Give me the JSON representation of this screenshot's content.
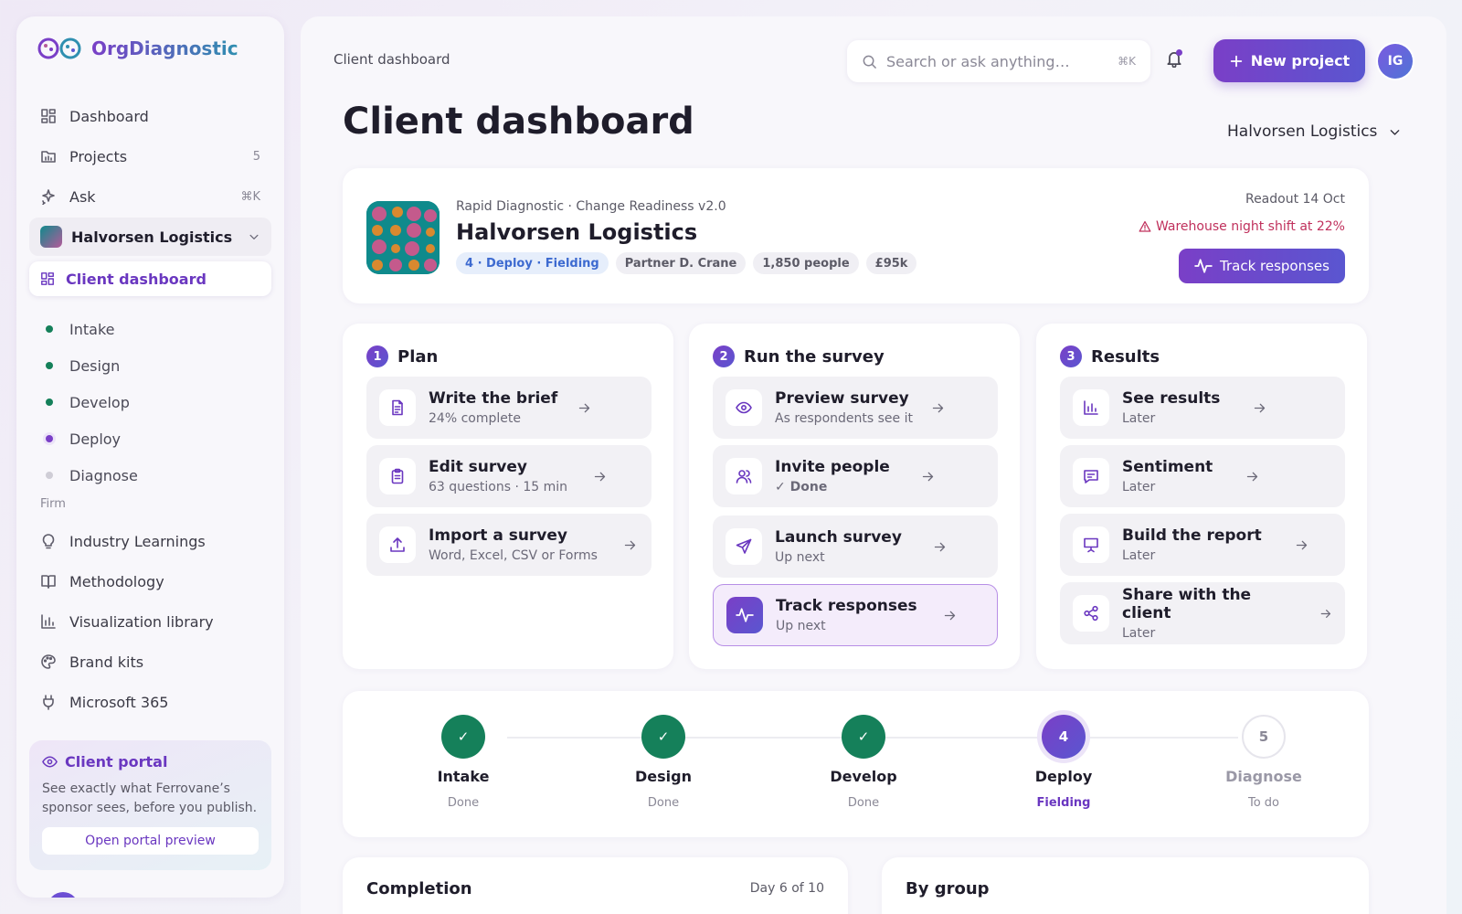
{
  "app": {
    "name": "OrgDiagnostic"
  },
  "sidebar": {
    "nav": [
      {
        "label": "Dashboard",
        "icon": "grid-icon",
        "meta": ""
      },
      {
        "label": "Projects",
        "icon": "folder-icon",
        "meta": "5"
      },
      {
        "label": "Ask",
        "icon": "sparkle-icon",
        "meta": "⌘K"
      }
    ],
    "workspace": "Halvorsen Logistics",
    "active_sub": "Client dashboard",
    "sub_items": [
      {
        "label": "Intake",
        "color": "#15805a"
      },
      {
        "label": "Design",
        "color": "#15805a"
      },
      {
        "label": "Develop",
        "color": "#15805a"
      },
      {
        "label": "Deploy",
        "color": "#7a3fc7"
      },
      {
        "label": "Diagnose",
        "color": "#cfcdd6"
      }
    ],
    "section_label": "Firm",
    "firm_items": [
      {
        "label": "Industry Learnings",
        "icon": "bulb-icon"
      },
      {
        "label": "Methodology",
        "icon": "book-icon"
      },
      {
        "label": "Visualization library",
        "icon": "chart-icon"
      },
      {
        "label": "Brand kits",
        "icon": "palette-icon"
      },
      {
        "label": "Microsoft 365",
        "icon": "plug-icon"
      }
    ],
    "portal": {
      "title": "Client portal",
      "description": "See exactly what Ferrovane’s sponsor sees, before you publish.",
      "button": "Open portal preview"
    }
  },
  "header": {
    "breadcrumb": "Client dashboard",
    "search_placeholder": "Search or ask anything…",
    "search_shortcut": "⌘K",
    "new_project": "New project",
    "avatar_initials": "IG",
    "page_title": "Client dashboard",
    "client_select": "Halvorsen Logistics"
  },
  "hero": {
    "subtitle": "Rapid Diagnostic · Change Readiness v2.0",
    "name": "Halvorsen Logistics",
    "tags": [
      "4 · Deploy · Fielding",
      "Partner D. Crane",
      "1,850 people",
      "£95k"
    ],
    "readout": "Readout 14 Oct",
    "warning": "Warehouse night shift at 22%",
    "track_button": "Track responses"
  },
  "columns": [
    {
      "num": "1",
      "title": "Plan",
      "steps": [
        {
          "title": "Write the brief",
          "sub": "24% complete",
          "icon": "document-icon"
        },
        {
          "title": "Edit survey",
          "sub": "63 questions · 15 min",
          "icon": "clipboard-icon"
        },
        {
          "title": "Import a survey",
          "sub": "Word, Excel, CSV or Forms",
          "icon": "upload-icon"
        }
      ]
    },
    {
      "num": "2",
      "title": "Run the survey",
      "steps": [
        {
          "title": "Preview survey",
          "sub": "As respondents see it",
          "icon": "eye-icon"
        },
        {
          "title": "Invite people",
          "sub": "Done",
          "icon": "users-icon"
        },
        {
          "title": "Launch survey",
          "sub": "Up next",
          "icon": "send-icon"
        },
        {
          "title": "Track responses",
          "sub": "Up next",
          "icon": "pulse-icon"
        }
      ]
    },
    {
      "num": "3",
      "title": "Results",
      "steps": [
        {
          "title": "See results",
          "sub": "Later",
          "icon": "bar-chart-icon"
        },
        {
          "title": "Sentiment",
          "sub": "Later",
          "icon": "message-icon"
        },
        {
          "title": "Build the report",
          "sub": "Later",
          "icon": "presentation-icon"
        },
        {
          "title": "Share with the client",
          "sub": "Later",
          "icon": "share-icon"
        }
      ]
    }
  ],
  "stages": [
    {
      "name": "Intake",
      "status": "Done",
      "marker": "✓"
    },
    {
      "name": "Design",
      "status": "Done",
      "marker": "✓"
    },
    {
      "name": "Develop",
      "status": "Done",
      "marker": "✓"
    },
    {
      "name": "Deploy",
      "status": "Fielding",
      "marker": "4"
    },
    {
      "name": "Diagnose",
      "status": "To do",
      "marker": "5"
    }
  ],
  "completion": {
    "title": "Completion",
    "meta": "Day 6 of 10"
  },
  "by_group": {
    "title": "By group"
  }
}
